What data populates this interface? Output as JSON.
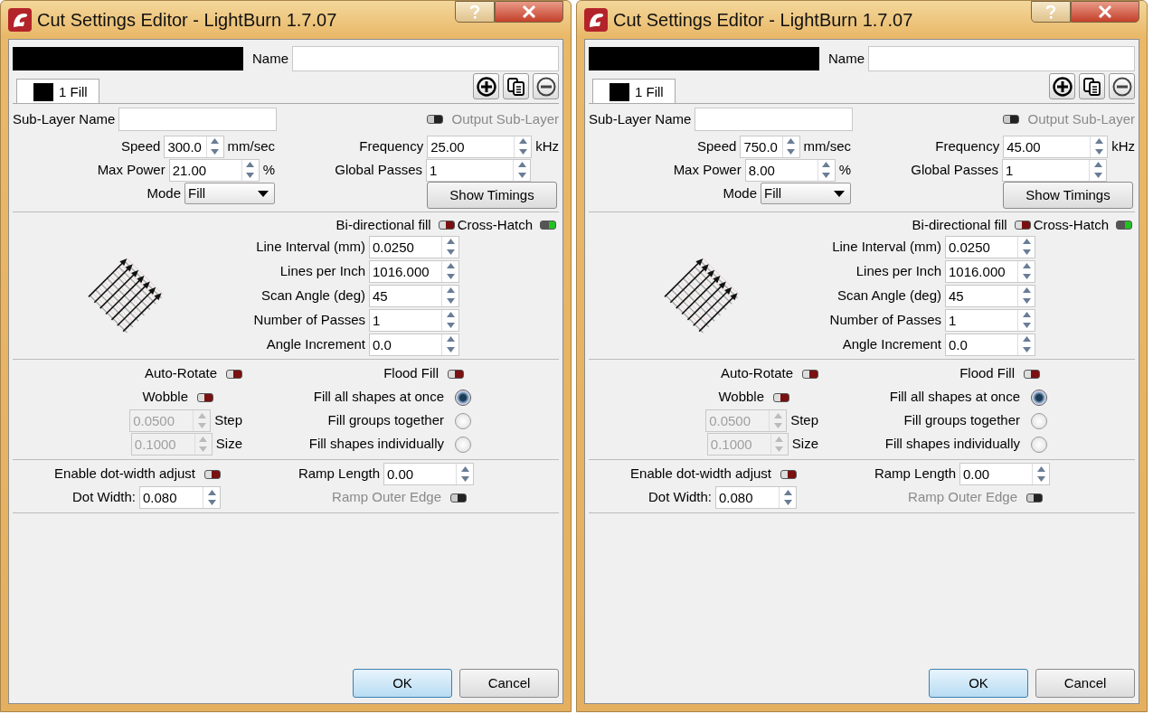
{
  "windows": [
    {
      "title": "Cut Settings Editor - LightBurn 1.7.07",
      "name_label": "Name",
      "tab": {
        "label": "1 Fill",
        "selected": true
      },
      "sublayer_label": "Sub-Layer Name",
      "output_sublayer": {
        "label": "Output Sub-Layer",
        "on": false,
        "disabled": true
      },
      "main_fields": [
        {
          "kind": "spin",
          "label": "Speed",
          "value": "300.0",
          "unit": "mm/sec"
        },
        {
          "kind": "spin",
          "label": "Max Power",
          "value": "21.00",
          "unit": "%"
        },
        {
          "kind": "dropdown",
          "label": "Mode",
          "value": "Fill"
        }
      ],
      "timing_fields": [
        {
          "kind": "spin",
          "label": "Frequency",
          "value": "25.00",
          "unit": "kHz"
        },
        {
          "kind": "spin",
          "label": "Global Passes",
          "value": "1"
        },
        {
          "kind": "button",
          "label": "Show Timings"
        }
      ],
      "fill_toggles": [
        {
          "label": "Bi-directional fill",
          "on": false
        },
        {
          "label": "Cross-Hatch",
          "on": true
        }
      ],
      "hatch_fields": [
        {
          "label": "Line Interval (mm)",
          "value": "0.0250"
        },
        {
          "label": "Lines per Inch",
          "value": "1016.000"
        },
        {
          "label": "Scan Angle (deg)",
          "value": "45"
        },
        {
          "label": "Number of Passes",
          "value": "1"
        },
        {
          "label": "Angle Increment",
          "value": "0.0"
        }
      ],
      "options_left": [
        {
          "kind": "toggle",
          "label": "Auto-Rotate",
          "on": false,
          "disabled": false
        },
        {
          "kind": "toggle",
          "label": "Wobble",
          "on": false,
          "disabled": false
        },
        {
          "kind": "spin",
          "value": "0.0500",
          "unit": "Step",
          "disabled": true
        },
        {
          "kind": "spin",
          "value": "0.1000",
          "unit": "Size",
          "disabled": true
        }
      ],
      "options_right": [
        {
          "kind": "toggle",
          "label": "Flood Fill",
          "on": false
        },
        {
          "kind": "radio",
          "label": "Fill all shapes at once",
          "selected": true
        },
        {
          "kind": "radio",
          "label": "Fill groups together",
          "selected": false
        },
        {
          "kind": "radio",
          "label": "Fill shapes individually",
          "selected": false
        }
      ],
      "dot_left": [
        {
          "kind": "toggle",
          "label": "Enable dot-width adjust",
          "on": false,
          "disabled": false
        },
        {
          "kind": "spin",
          "label": "Dot Width:",
          "value": "0.080",
          "disabled": false
        }
      ],
      "dot_right": [
        {
          "kind": "spin",
          "label": "Ramp Length",
          "value": "0.00",
          "disabled": false
        },
        {
          "kind": "toggle",
          "label": "Ramp Outer Edge",
          "on": false,
          "disabled": true
        }
      ],
      "buttons": [
        {
          "label": "OK",
          "default": true
        },
        {
          "label": "Cancel",
          "default": false
        }
      ]
    },
    {
      "title": "Cut Settings Editor - LightBurn 1.7.07",
      "name_label": "Name",
      "tab": {
        "label": "1 Fill",
        "selected": true
      },
      "sublayer_label": "Sub-Layer Name",
      "output_sublayer": {
        "label": "Output Sub-Layer",
        "on": false,
        "disabled": true
      },
      "main_fields": [
        {
          "kind": "spin",
          "label": "Speed",
          "value": "750.0",
          "unit": "mm/sec"
        },
        {
          "kind": "spin",
          "label": "Max Power",
          "value": "8.00",
          "unit": "%"
        },
        {
          "kind": "dropdown",
          "label": "Mode",
          "value": "Fill"
        }
      ],
      "timing_fields": [
        {
          "kind": "spin",
          "label": "Frequency",
          "value": "45.00",
          "unit": "kHz"
        },
        {
          "kind": "spin",
          "label": "Global Passes",
          "value": "1"
        },
        {
          "kind": "button",
          "label": "Show Timings"
        }
      ],
      "fill_toggles": [
        {
          "label": "Bi-directional fill",
          "on": false
        },
        {
          "label": "Cross-Hatch",
          "on": true
        }
      ],
      "hatch_fields": [
        {
          "label": "Line Interval (mm)",
          "value": "0.0250"
        },
        {
          "label": "Lines per Inch",
          "value": "1016.000"
        },
        {
          "label": "Scan Angle (deg)",
          "value": "45"
        },
        {
          "label": "Number of Passes",
          "value": "1"
        },
        {
          "label": "Angle Increment",
          "value": "0.0"
        }
      ],
      "options_left": [
        {
          "kind": "toggle",
          "label": "Auto-Rotate",
          "on": false,
          "disabled": false
        },
        {
          "kind": "toggle",
          "label": "Wobble",
          "on": false,
          "disabled": false
        },
        {
          "kind": "spin",
          "value": "0.0500",
          "unit": "Step",
          "disabled": true
        },
        {
          "kind": "spin",
          "value": "0.1000",
          "unit": "Size",
          "disabled": true
        }
      ],
      "options_right": [
        {
          "kind": "toggle",
          "label": "Flood Fill",
          "on": false
        },
        {
          "kind": "radio",
          "label": "Fill all shapes at once",
          "selected": true
        },
        {
          "kind": "radio",
          "label": "Fill groups together",
          "selected": false
        },
        {
          "kind": "radio",
          "label": "Fill shapes individually",
          "selected": false
        }
      ],
      "dot_left": [
        {
          "kind": "toggle",
          "label": "Enable dot-width adjust",
          "on": false,
          "disabled": false
        },
        {
          "kind": "spin",
          "label": "Dot Width:",
          "value": "0.080",
          "disabled": false
        }
      ],
      "dot_right": [
        {
          "kind": "spin",
          "label": "Ramp Length",
          "value": "0.00",
          "disabled": false
        },
        {
          "kind": "toggle",
          "label": "Ramp Outer Edge",
          "on": false,
          "disabled": true
        }
      ],
      "buttons": [
        {
          "label": "OK",
          "default": true
        },
        {
          "label": "Cancel",
          "default": false
        }
      ]
    }
  ]
}
